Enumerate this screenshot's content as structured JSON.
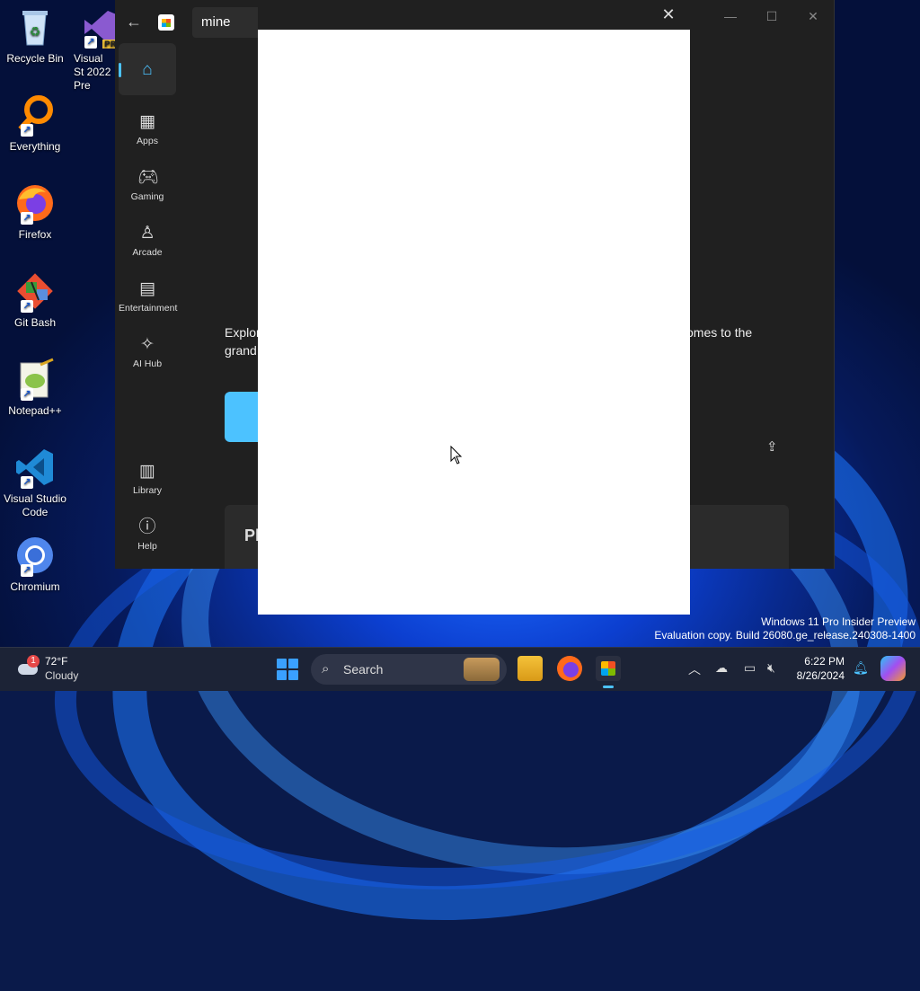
{
  "desktop": {
    "icons": [
      {
        "label": "Recycle Bin"
      },
      {
        "label": "Everything"
      },
      {
        "label": "Firefox"
      },
      {
        "label": "Git Bash"
      },
      {
        "label": "Notepad++"
      },
      {
        "label": "Visual Studio Code"
      },
      {
        "label": "Chromium"
      },
      {
        "label": "Visual St 2022 Pre"
      }
    ]
  },
  "store": {
    "search_value": "mine",
    "nav": [
      {
        "label": "",
        "icon": "home-icon"
      },
      {
        "label": "Apps",
        "icon": "apps-icon"
      },
      {
        "label": "Gaming",
        "icon": "gamepad-icon"
      },
      {
        "label": "Arcade",
        "icon": "joystick-icon"
      },
      {
        "label": "Entertainment",
        "icon": "clapperboard-icon"
      },
      {
        "label": "AI Hub",
        "icon": "sparkle-icon"
      },
      {
        "label": "Library",
        "icon": "library-icon"
      },
      {
        "label": "Help",
        "icon": "help-icon"
      }
    ],
    "hero_left_1": "Explor",
    "hero_left_2": "grand",
    "hero_right_1": "omes to the",
    "card_text": "Pl"
  },
  "watermark": {
    "line1": "Windows 11 Pro Insider Preview",
    "line2": "Evaluation copy. Build 26080.ge_release.240308-1400"
  },
  "taskbar": {
    "weather_temp": "72°F",
    "weather_cond": "Cloudy",
    "weather_badge": "1",
    "search_label": "Search",
    "time": "6:22 PM",
    "date": "8/26/2024"
  }
}
